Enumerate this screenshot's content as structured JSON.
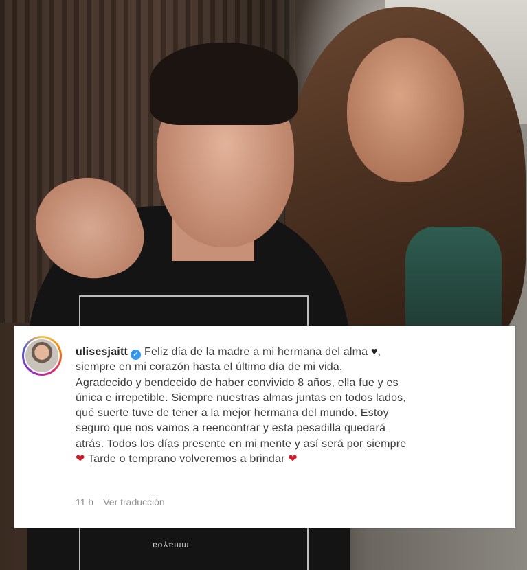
{
  "photo": {
    "shirt_print_text": "ɐo⅄ɐɯɯ"
  },
  "post": {
    "username": "ulisesjaitt",
    "verified_icon": "verified-badge-icon",
    "caption_lines": [
      "Feliz día de la madre a mi hermana del alma",
      "siempre en mi corazón hasta el último día de mi vida.",
      "Agradecido y bendecido de haber convivido 8 años, ella fue y es",
      "única e irrepetible. Siempre nuestras almas juntas en todos lados,",
      "qué suerte tuve de tener a la mejor hermana del mundo. Estoy",
      "seguro que nos vamos a reencontrar y esta pesadilla quedará",
      "atrás. Todos los días presente en mi mente y así será por siempre",
      "Tarde o temprano volveremos a brindar"
    ],
    "line1_suffix": ",",
    "emoji_black_heart": "♥",
    "emoji_red_heart": "❤",
    "timestamp": "11 h",
    "translate_link": "Ver traducción",
    "colors": {
      "verified": "#3897f0",
      "heart": "#d0192b",
      "meta": "#8e8e8e"
    }
  }
}
